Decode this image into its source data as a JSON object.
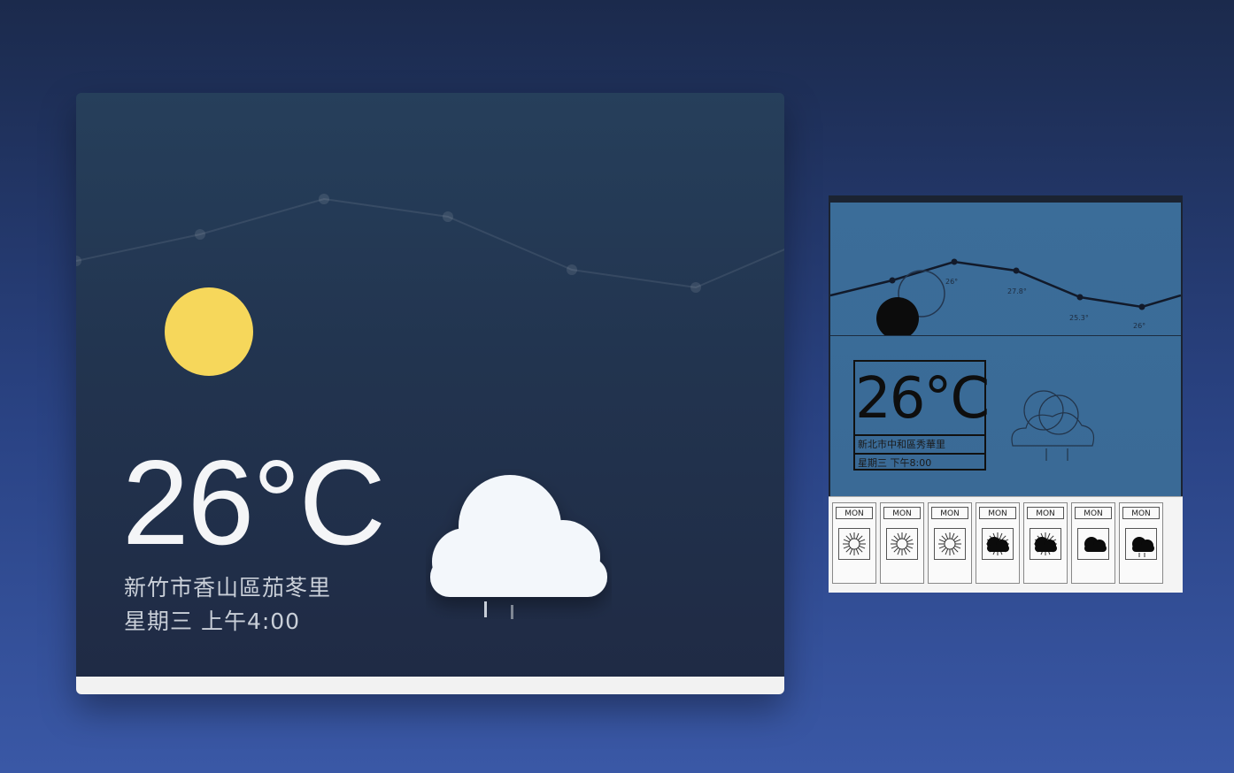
{
  "colors": {
    "sun": "#f6d75b",
    "cloud": "#f3f7fb",
    "temperature_text": "#f4f5f7",
    "secondary_text": "#c9cfd8"
  },
  "weather_card": {
    "temperature": "26°C",
    "location": "新竹市香山區茄苳里",
    "datetime": "星期三 上午4:00",
    "sun_icon": "sun-icon",
    "condition_icon": "rain-cloud-icon",
    "trend_points": [
      -10,
      20,
      60,
      40,
      -20,
      -40,
      20
    ]
  },
  "sketch": {
    "temperature": "26°C",
    "location": "新北市中和區秀華里",
    "datetime": "星期三 下午8:00",
    "chart_labels": [
      "26°",
      "27.8°",
      "25.3°",
      "26°"
    ],
    "days": [
      {
        "label": "MON",
        "icon": "sun-icon"
      },
      {
        "label": "MON",
        "icon": "sun-icon"
      },
      {
        "label": "MON",
        "icon": "sun-icon"
      },
      {
        "label": "MON",
        "icon": "cloud-sun-icon"
      },
      {
        "label": "MON",
        "icon": "cloud-sun-icon"
      },
      {
        "label": "MON",
        "icon": "cloud-icon"
      },
      {
        "label": "MON",
        "icon": "rain-cloud-icon"
      }
    ]
  }
}
